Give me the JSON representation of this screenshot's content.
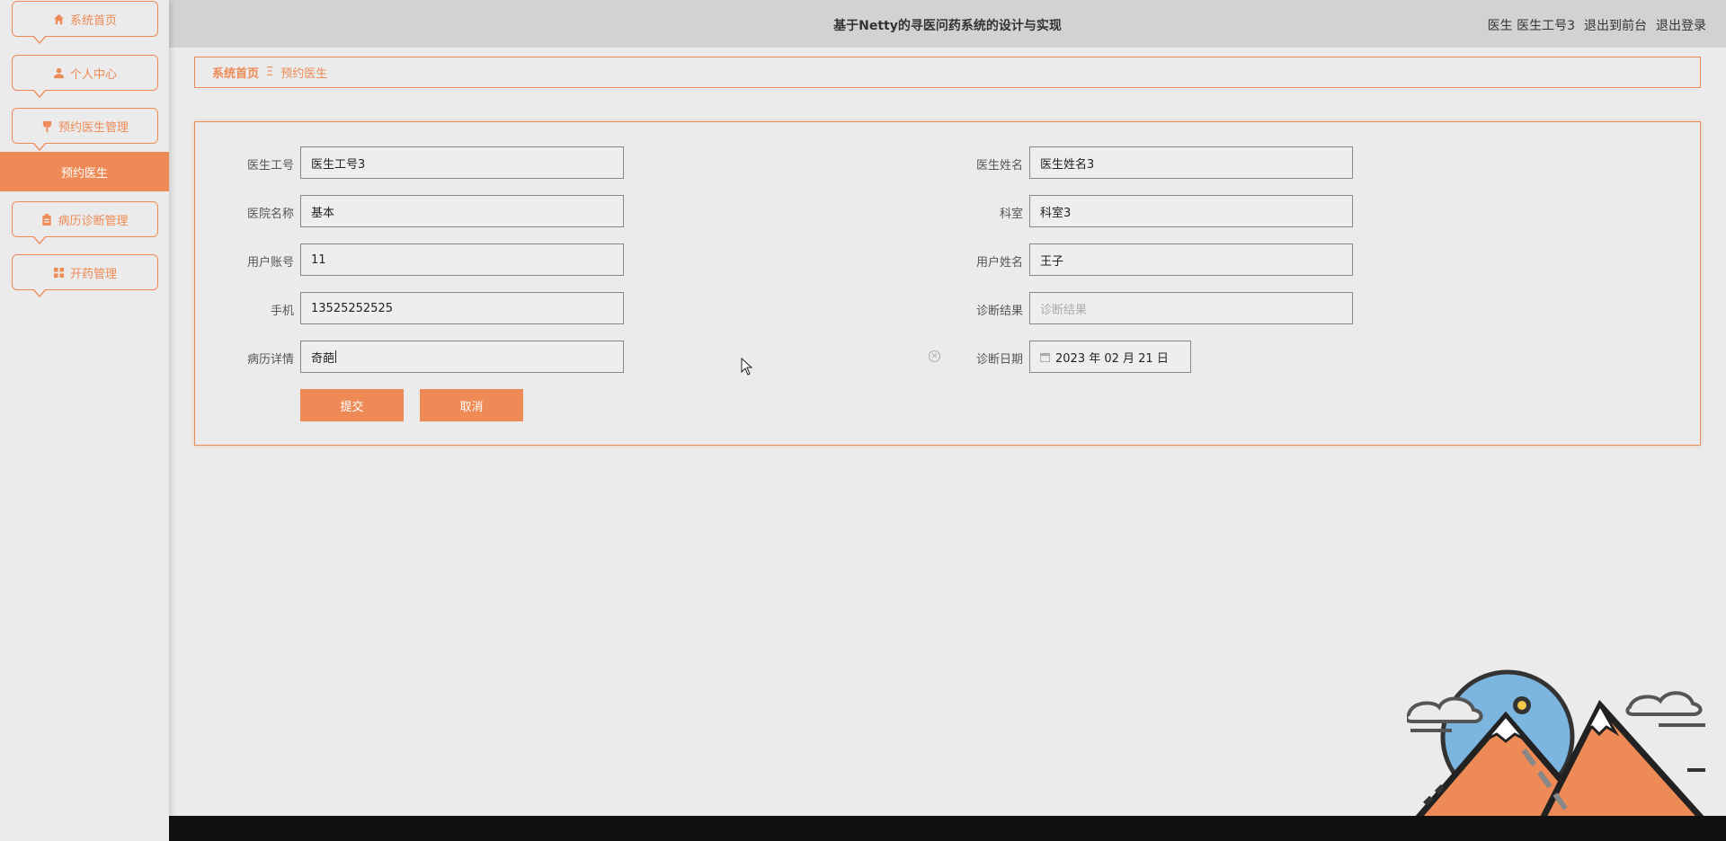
{
  "app": {
    "title": "基于Netty的寻医问药系统的设计与实现",
    "user_role": "医生",
    "user_name": "医生工号3",
    "front_link": "退出到前台",
    "logout_link": "退出登录"
  },
  "sidebar": {
    "items": [
      {
        "label": "系统首页",
        "icon": "home-icon"
      },
      {
        "label": "个人中心",
        "icon": "user-icon"
      },
      {
        "label": "预约医生管理",
        "icon": "pin-icon"
      },
      {
        "label": "病历诊断管理",
        "icon": "clipboard-icon"
      },
      {
        "label": "开药管理",
        "icon": "grid-icon"
      }
    ],
    "active_sub": "预约医生"
  },
  "breadcrumb": {
    "home": "系统首页",
    "separator": "Ξ",
    "current": "预约医生"
  },
  "form": {
    "doctor_id": {
      "label": "医生工号",
      "value": "医生工号3"
    },
    "doctor_name": {
      "label": "医生姓名",
      "value": "医生姓名3"
    },
    "hospital": {
      "label": "医院名称",
      "value": "基本"
    },
    "department": {
      "label": "科室",
      "value": "科室3"
    },
    "user_account": {
      "label": "用户账号",
      "value": "11"
    },
    "user_name": {
      "label": "用户姓名",
      "value": "王子"
    },
    "phone": {
      "label": "手机",
      "value": "13525252525"
    },
    "diagnosis": {
      "label": "诊断结果",
      "value": "",
      "placeholder": "诊断结果"
    },
    "record": {
      "label": "病历详情",
      "value": "奇葩"
    },
    "diag_date": {
      "label": "诊断日期",
      "value": "2023 年 02 月 21 日"
    },
    "submit": "提交",
    "cancel": "取消"
  },
  "colors": {
    "accent": "#ee8a55",
    "header_bg": "#d2d2d2",
    "page_bg": "#ebebeb"
  }
}
